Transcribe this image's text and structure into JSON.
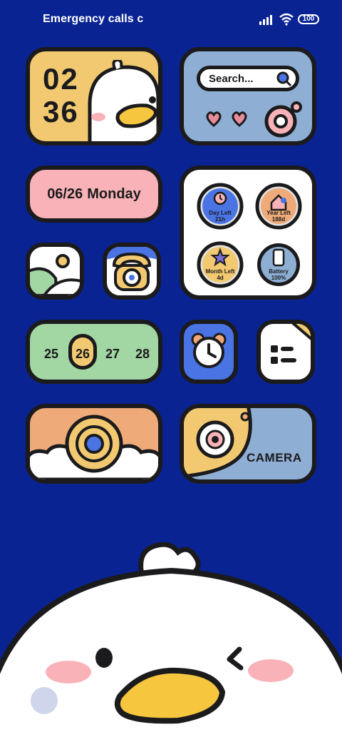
{
  "status_bar": {
    "carrier_text": "Emergency calls c",
    "battery_level": "100",
    "icons": [
      "signal-icon",
      "wifi-icon",
      "battery-icon"
    ]
  },
  "clock_widget": {
    "hours": "02",
    "minutes": "36"
  },
  "search_widget": {
    "placeholder": "Search..."
  },
  "date_widget": {
    "date": "06/26",
    "weekday": "Monday"
  },
  "stats_widget": {
    "day": {
      "label": "Day Left",
      "value": "21h"
    },
    "year": {
      "label": "Year Left",
      "value": "188d"
    },
    "month": {
      "label": "Month Left",
      "value": "4d"
    },
    "battery": {
      "label": "Battery",
      "value": "100%"
    }
  },
  "calendar_strip": {
    "days": [
      "25",
      "26",
      "27",
      "28"
    ],
    "selected": "26"
  },
  "camera_widget": {
    "label": "CAMERA"
  },
  "apps": [
    "gallery-app",
    "phone-app",
    "clock-app",
    "settings-app",
    "camera-app"
  ],
  "colors": {
    "background": "#0a2393",
    "yellow": "#f2c970",
    "blue_grey": "#8eaed4",
    "pink": "#f9b3b8",
    "green": "#a2d6a2",
    "orange": "#eeaa78",
    "royal_blue": "#4a74e4",
    "outline": "#1b1b1d"
  }
}
